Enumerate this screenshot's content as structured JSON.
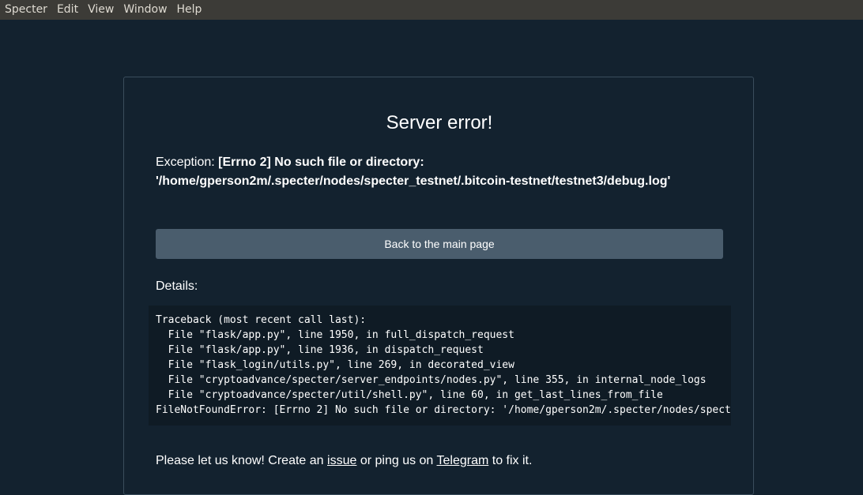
{
  "menubar": {
    "items": [
      "Specter",
      "Edit",
      "View",
      "Window",
      "Help"
    ]
  },
  "error": {
    "title": "Server error!",
    "exception_label": "Exception:",
    "exception_message": "[Errno 2] No such file or directory: '/home/gperson2m/.specter/nodes/specter_testnet/.bitcoin-testnet/testnet3/debug.log'",
    "back_button": "Back to the main page",
    "details_label": "Details:",
    "traceback_lines": [
      "Traceback (most recent call last):",
      "  File \"flask/app.py\", line 1950, in full_dispatch_request",
      "  File \"flask/app.py\", line 1936, in dispatch_request",
      "  File \"flask_login/utils.py\", line 269, in decorated_view",
      "  File \"cryptoadvance/specter/server_endpoints/nodes.py\", line 355, in internal_node_logs",
      "  File \"cryptoadvance/specter/util/shell.py\", line 60, in get_last_lines_from_file",
      "FileNotFoundError: [Errno 2] No such file or directory: '/home/gperson2m/.specter/nodes/spect"
    ]
  },
  "footer": {
    "text_before": "Please let us know! Create an ",
    "issue_link": "issue",
    "text_middle": " or ping us on ",
    "telegram_link": "Telegram",
    "text_after": " to fix it."
  }
}
